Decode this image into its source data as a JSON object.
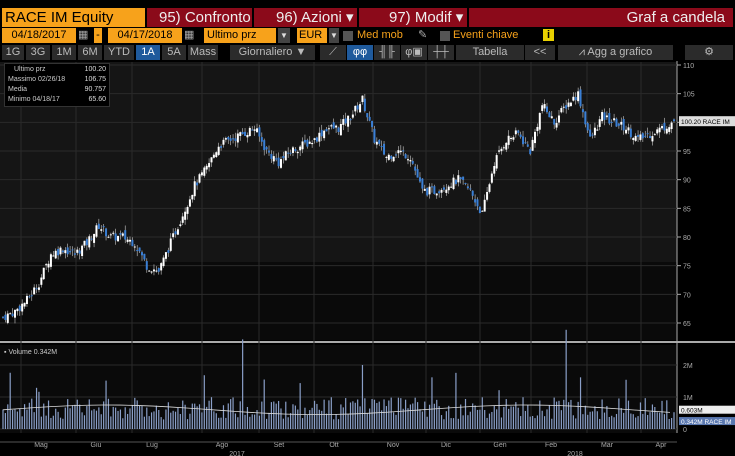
{
  "header": {
    "ticker": "RACE IM Equity",
    "compare": "95) Confronto",
    "actions": "96) Azioni",
    "modify": "97) Modif",
    "title": "Graf a candela"
  },
  "controls": {
    "start_date": "04/18/2017",
    "end_date": "04/17/2018",
    "price_field": "Ultimo prz",
    "currency": "EUR",
    "moving_avg": "Med mob",
    "key_events": "Eventi chiave"
  },
  "periods": [
    "1G",
    "3G",
    "1M",
    "6M",
    "YTD",
    "1A",
    "5A",
    "Mass"
  ],
  "selected_period": "1A",
  "frequency": "Giornaliero",
  "toolbar": {
    "table": "Tabella",
    "back": "<<",
    "add_to_chart": "Agg a grafico"
  },
  "legend": [
    {
      "label": "Ultimo prz",
      "value": "100.20"
    },
    {
      "label": "Massimo 02/26/18",
      "value": "106.75"
    },
    {
      "label": "Media",
      "value": "90.757"
    },
    {
      "label": "Minimo 04/18/17",
      "value": "65.60"
    }
  ],
  "price_tag": "100.20 RACE IM",
  "volume_legend": "Volume 0.342M",
  "volume_tags": {
    "avg": "0.603M",
    "last": "0.342M RACE IM"
  },
  "colors": {
    "up": "#ffffff",
    "down": "#3a7fd5",
    "orange": "#f7a21b",
    "red": "#8b0a1a"
  },
  "chart_data": {
    "type": "candlestick",
    "price_axis": {
      "ticks": [
        65,
        70,
        75,
        80,
        85,
        90,
        95,
        100,
        105,
        110
      ],
      "range": [
        63,
        110
      ]
    },
    "volume_axis": {
      "ticks": [
        "0",
        "1M",
        "2M"
      ],
      "range_millions": [
        0,
        3.2
      ]
    },
    "months": [
      "Mag",
      "Giu",
      "Lug",
      "Ago",
      "Set",
      "Ott",
      "Nov",
      "Dic",
      "Gen",
      "Feb",
      "Mar",
      "Apr"
    ],
    "years": [
      "2017",
      "2018"
    ],
    "weekly_close": [
      66,
      67,
      69,
      72,
      77,
      78,
      77,
      79,
      82,
      80,
      80,
      79,
      75,
      74,
      79,
      84,
      89,
      92,
      96,
      97,
      98,
      99,
      95,
      93,
      95,
      96,
      97,
      99,
      99,
      101,
      104,
      97,
      94,
      95,
      94,
      88,
      88,
      89,
      90,
      88,
      84,
      93,
      97,
      98,
      95,
      103,
      100,
      103,
      105,
      97,
      101,
      100,
      99,
      97,
      98,
      99,
      100.2
    ],
    "volume_spikes_millions": [
      {
        "week": 20,
        "v": 2.8
      },
      {
        "week": 30,
        "v": 2.0
      },
      {
        "week": 47,
        "v": 3.1
      }
    ],
    "volume_avg_millions": 0.6
  }
}
